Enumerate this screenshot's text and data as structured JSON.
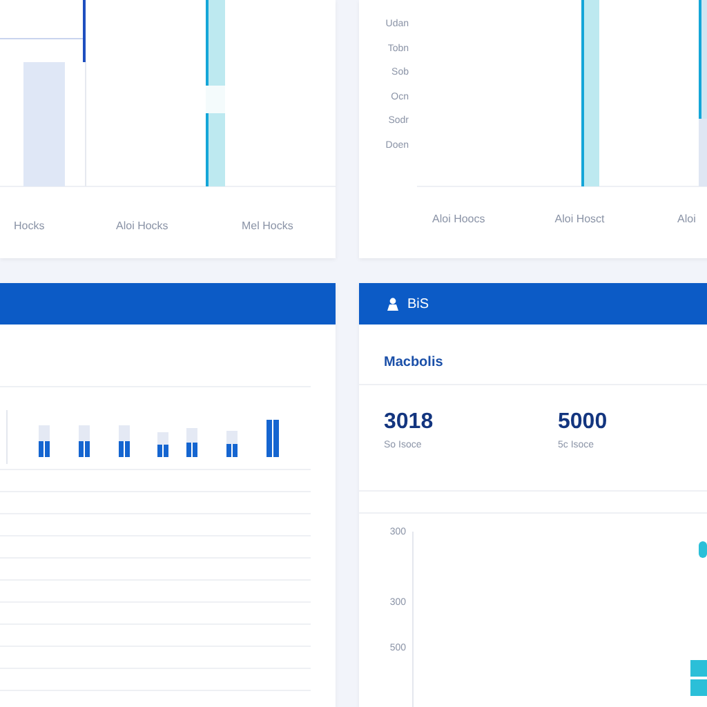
{
  "panels": [
    {
      "kind": "bar_card",
      "x_labels": [
        "Hocks",
        "Aloi Hocks",
        "Mel Hocks"
      ]
    },
    {
      "kind": "axis_card",
      "y_labels": [
        "Udan",
        "Tobn",
        "Sob",
        "Ocn",
        "Sodr",
        "Doen"
      ],
      "x_labels": [
        "Aloi Hoocs",
        "Aloi Hosct",
        "Aloi"
      ]
    },
    {
      "kind": "list_card"
    },
    {
      "kind": "stats_card",
      "header": "BiS",
      "title": "Macbolis",
      "stats": [
        {
          "value": "3018",
          "caption": "So Isoce"
        },
        {
          "value": "5000",
          "caption": "5c Isoce"
        }
      ],
      "axis_labels": [
        "300",
        "300",
        "500"
      ]
    }
  ]
}
